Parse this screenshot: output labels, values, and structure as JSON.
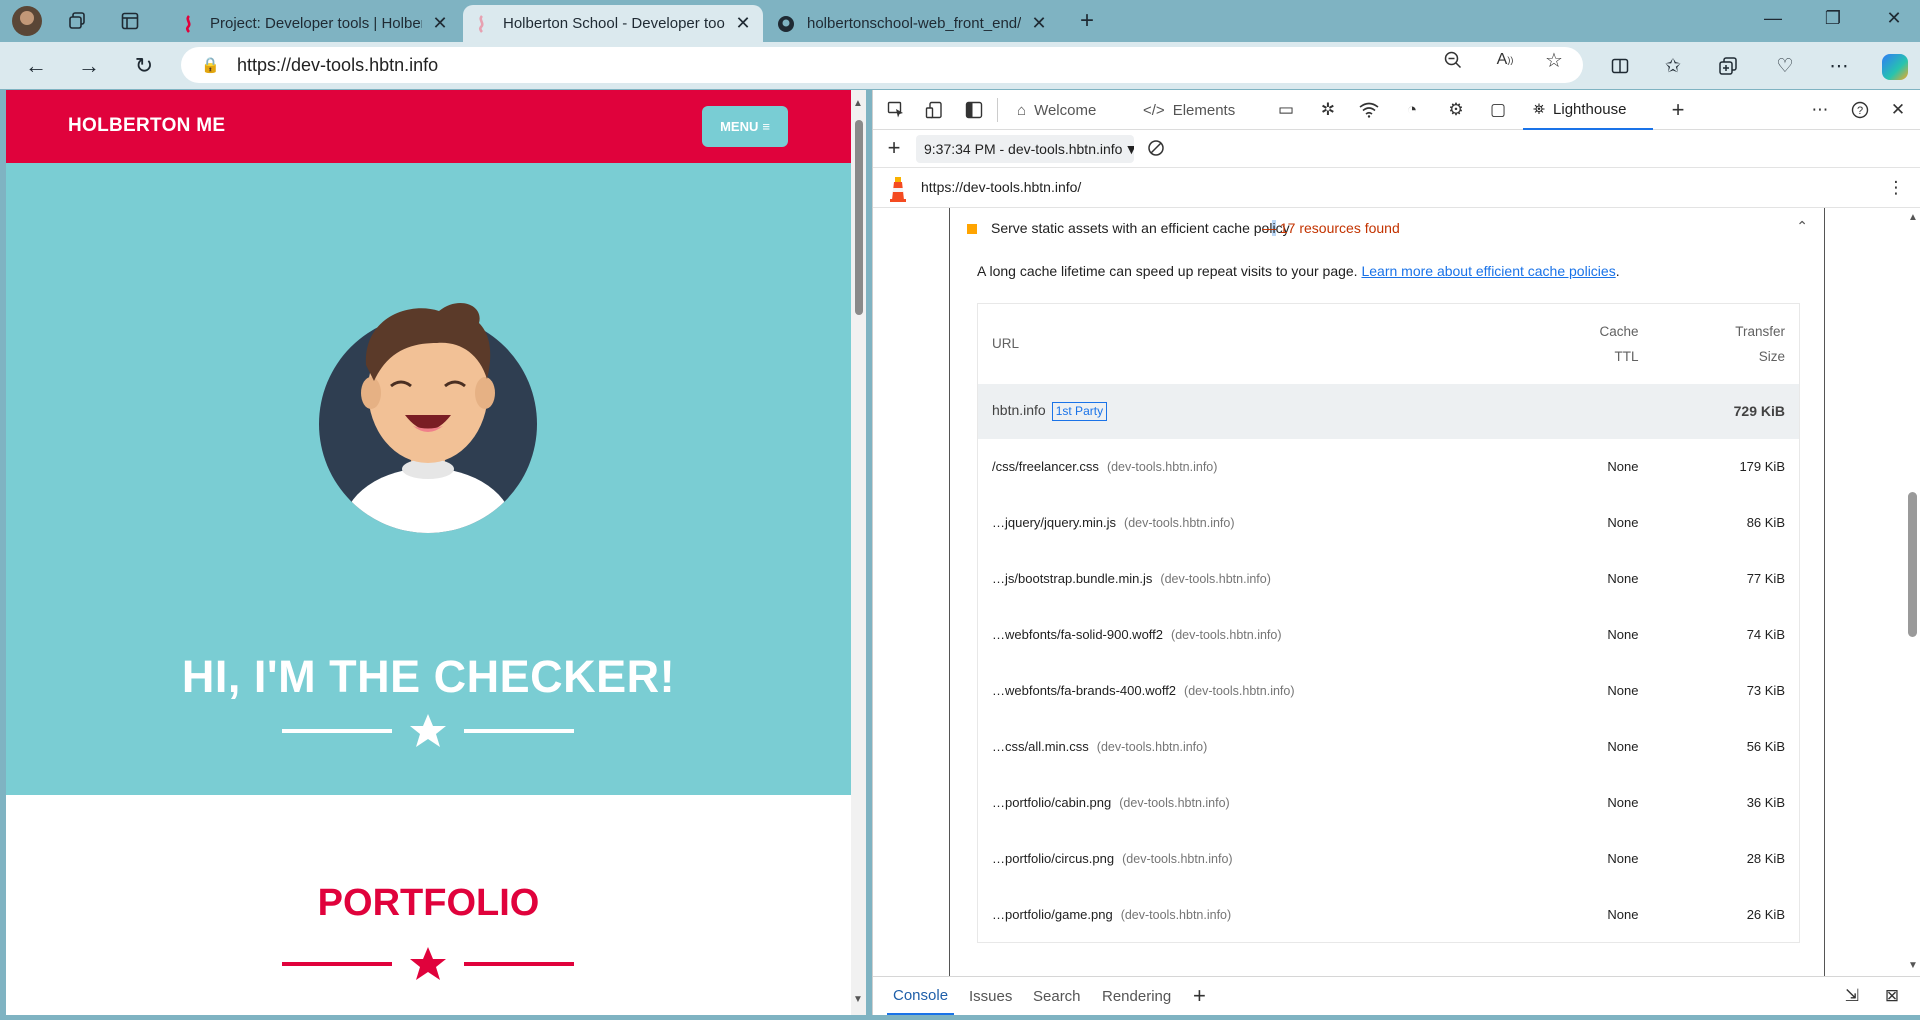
{
  "browser": {
    "tabs": [
      {
        "title": "Project: Developer tools | Holberton",
        "favicon": "holberton-favicon",
        "active": false
      },
      {
        "title": "Holberton School - Developer tools",
        "favicon": "holberton-favicon",
        "active": true
      },
      {
        "title": "holbertonschool-web_front_end/",
        "favicon": "github-favicon",
        "active": false
      }
    ],
    "address": {
      "url": "https://dev-tools.hbtn.info"
    }
  },
  "page": {
    "brand": "HOLBERTON ME",
    "menu_label": "MENU",
    "hero_title": "HI, I'M THE CHECKER!",
    "portfolio_title": "PORTFOLIO",
    "colors": {
      "header": "#e0023c",
      "hero": "#7acdd3",
      "menu_button": "#79cdd4"
    }
  },
  "devtools": {
    "tabs": [
      {
        "label": "Welcome",
        "icon": "home-icon"
      },
      {
        "label": "Elements",
        "icon": "code-icon"
      },
      {
        "label": "Lighthouse",
        "icon": "lighthouse-icon",
        "active": true
      }
    ],
    "report_select": "9:37:34 PM - dev-tools.hbtn.info",
    "report_url": "https://dev-tools.hbtn.info/",
    "audit": {
      "title_before": "Serve static assets with an efficient cache pol",
      "title_cursor": "i",
      "title_after": "cy",
      "summary": "— 17 resources found",
      "description": "A long cache lifetime can speed up repeat visits to your page.",
      "learn_more": "Learn more about efficient cache policies",
      "learn_more_suffix": ".",
      "columns": {
        "url": "URL",
        "ttl_1": "Cache",
        "ttl_2": "TTL",
        "size_1": "Transfer",
        "size_2": "Size"
      },
      "group": {
        "name": "hbtn.info",
        "badge": "1st Party",
        "size": "729 KiB"
      },
      "rows": [
        {
          "url": "/css/freelancer.css",
          "host": "(dev-tools.hbtn.info)",
          "ttl": "None",
          "size": "179 KiB"
        },
        {
          "url": "…jquery/jquery.min.js",
          "host": "(dev-tools.hbtn.info)",
          "ttl": "None",
          "size": "86 KiB"
        },
        {
          "url": "…js/bootstrap.bundle.min.js",
          "host": "(dev-tools.hbtn.info)",
          "ttl": "None",
          "size": "77 KiB"
        },
        {
          "url": "…webfonts/fa-solid-900.woff2",
          "host": "(dev-tools.hbtn.info)",
          "ttl": "None",
          "size": "74 KiB"
        },
        {
          "url": "…webfonts/fa-brands-400.woff2",
          "host": "(dev-tools.hbtn.info)",
          "ttl": "None",
          "size": "73 KiB"
        },
        {
          "url": "…css/all.min.css",
          "host": "(dev-tools.hbtn.info)",
          "ttl": "None",
          "size": "56 KiB"
        },
        {
          "url": "…portfolio/cabin.png",
          "host": "(dev-tools.hbtn.info)",
          "ttl": "None",
          "size": "36 KiB"
        },
        {
          "url": "…portfolio/circus.png",
          "host": "(dev-tools.hbtn.info)",
          "ttl": "None",
          "size": "28 KiB"
        },
        {
          "url": "…portfolio/game.png",
          "host": "(dev-tools.hbtn.info)",
          "ttl": "None",
          "size": "26 KiB"
        }
      ]
    },
    "drawer_tabs": [
      "Console",
      "Issues",
      "Search",
      "Rendering"
    ]
  }
}
